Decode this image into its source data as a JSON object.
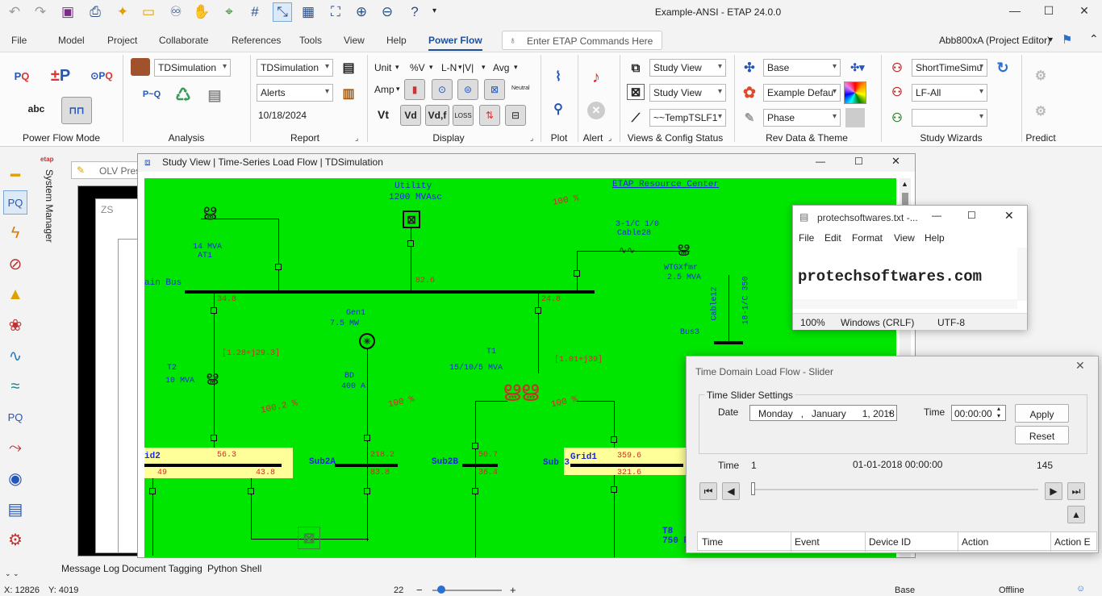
{
  "app": {
    "title": "Example-ANSI - ETAP 24.0.0"
  },
  "menu": [
    "File",
    "Model",
    "Project",
    "Collaborate",
    "References",
    "Tools",
    "View",
    "Help",
    "Power Flow"
  ],
  "command_search": {
    "placeholder": "Enter ETAP Commands Here"
  },
  "user": "Abb800xA (Project Editor)",
  "ribbon": {
    "groups": [
      "Power Flow Mode",
      "Analysis",
      "Report",
      "Display",
      "Plot",
      "Alert",
      "Views & Config Status",
      "Rev Data & Theme",
      "Study Wizards",
      "Predict"
    ],
    "analysis_case": "TDSimulation",
    "report_case": "TDSimulation",
    "report_alerts": "Alerts",
    "report_date": "10/18/2024",
    "display": {
      "unit": "Unit",
      "pct_v": "%V",
      "l_n": "L-N",
      "abs_v": "|V|",
      "avg": "Avg",
      "amp": "Amp",
      "vt": "Vt",
      "vd": "Vd",
      "vdf": "Vd,f",
      "loss": "LOSS",
      "neutral": "Neutral"
    },
    "views": [
      "Study View",
      "Study View",
      "~~TempTSLF1"
    ],
    "rev": [
      "Base",
      "Example Defau",
      "Phase"
    ],
    "wizards": [
      "ShortTimeSimu",
      "LF-All",
      ""
    ]
  },
  "sidebar": {
    "label": "System Manager"
  },
  "tabs": {
    "olv": "OLV Pres",
    "zs": "ZS"
  },
  "study_window": {
    "title": "Study View | Time-Series Load Flow | TDSimulation"
  },
  "diagram": {
    "labels": {
      "utility": "Utility",
      "utility_rating": "1200 MVAsc",
      "resource_center": "ETAP Resource Center",
      "pct_top": "100 %",
      "at1_rating": "14 MVA",
      "at1": "AT1",
      "main_bus": "ain Bus",
      "cable28_spec": "3-1/C 1/0",
      "cable28": "Cable28",
      "wtgxfmr": "WTGXfmr",
      "wtgxfmr_rating": "2.5 MVA",
      "cable12": "Cable12",
      "cable12_spec": "18-1/C 350",
      "bus3": "Bus3",
      "gen1": "Gen1",
      "gen1_rating": "7.5 MW",
      "t2": "T2",
      "t2_rating": "10 MVA",
      "t2_flow": "[1.28+j29.3]",
      "t1": "T1",
      "t1_rating": "15/10/5 MVA",
      "t1_flow": "[1.01+j39]",
      "bd": "BD",
      "bd_rating": "400 A",
      "pct_left": "100.2 %",
      "pct_mid": "100 %",
      "pct_right": "100 %",
      "grid2": "id2",
      "sub2a": "Sub2A",
      "sub2b": "Sub2B",
      "sub3": "Sub 3",
      "grid1": "Grid1",
      "t8": "T8",
      "t8_rating": "750 k"
    },
    "values": {
      "utility": "82.6",
      "main_left": "34.8",
      "main_right": "24.8",
      "grid2_top": "56.3",
      "grid2_bl": "49",
      "grid2_br": "43.8",
      "sub2a_top": "218.2",
      "sub2a_bot": "83.8",
      "sub2b_top": "50.7",
      "sub2b_bot": "36.4",
      "grid1_top": "359.6",
      "grid1_bot": "321.6"
    }
  },
  "notepad": {
    "title": "protechsoftwares.txt -...",
    "menu": [
      "File",
      "Edit",
      "Format",
      "View",
      "Help"
    ],
    "content": "protechsoftwares.com",
    "zoom": "100%",
    "eol": "Windows (CRLF)",
    "encoding": "UTF-8"
  },
  "slider": {
    "title": "Time Domain Load Flow - Slider",
    "group": "Time Slider Settings",
    "date_label": "Date",
    "date_value": "Monday   ,   January      1, 2018",
    "time_label": "Time",
    "time_value": "00:00:00",
    "apply": "Apply",
    "reset": "Reset",
    "time_row_label": "Time",
    "start": "1",
    "current": "01-01-2018 00:00:00",
    "end": "145",
    "position": 0,
    "columns": [
      "Time",
      "Event",
      "Device ID",
      "Action",
      "Action E"
    ]
  },
  "bottom_tabs": [
    "Message Log",
    "Document Tagging",
    "Python Shell"
  ],
  "status": {
    "x": "X: 12826",
    "y": "Y: 4019",
    "zoom": "22",
    "rev": "Base",
    "mode": "Offline"
  }
}
